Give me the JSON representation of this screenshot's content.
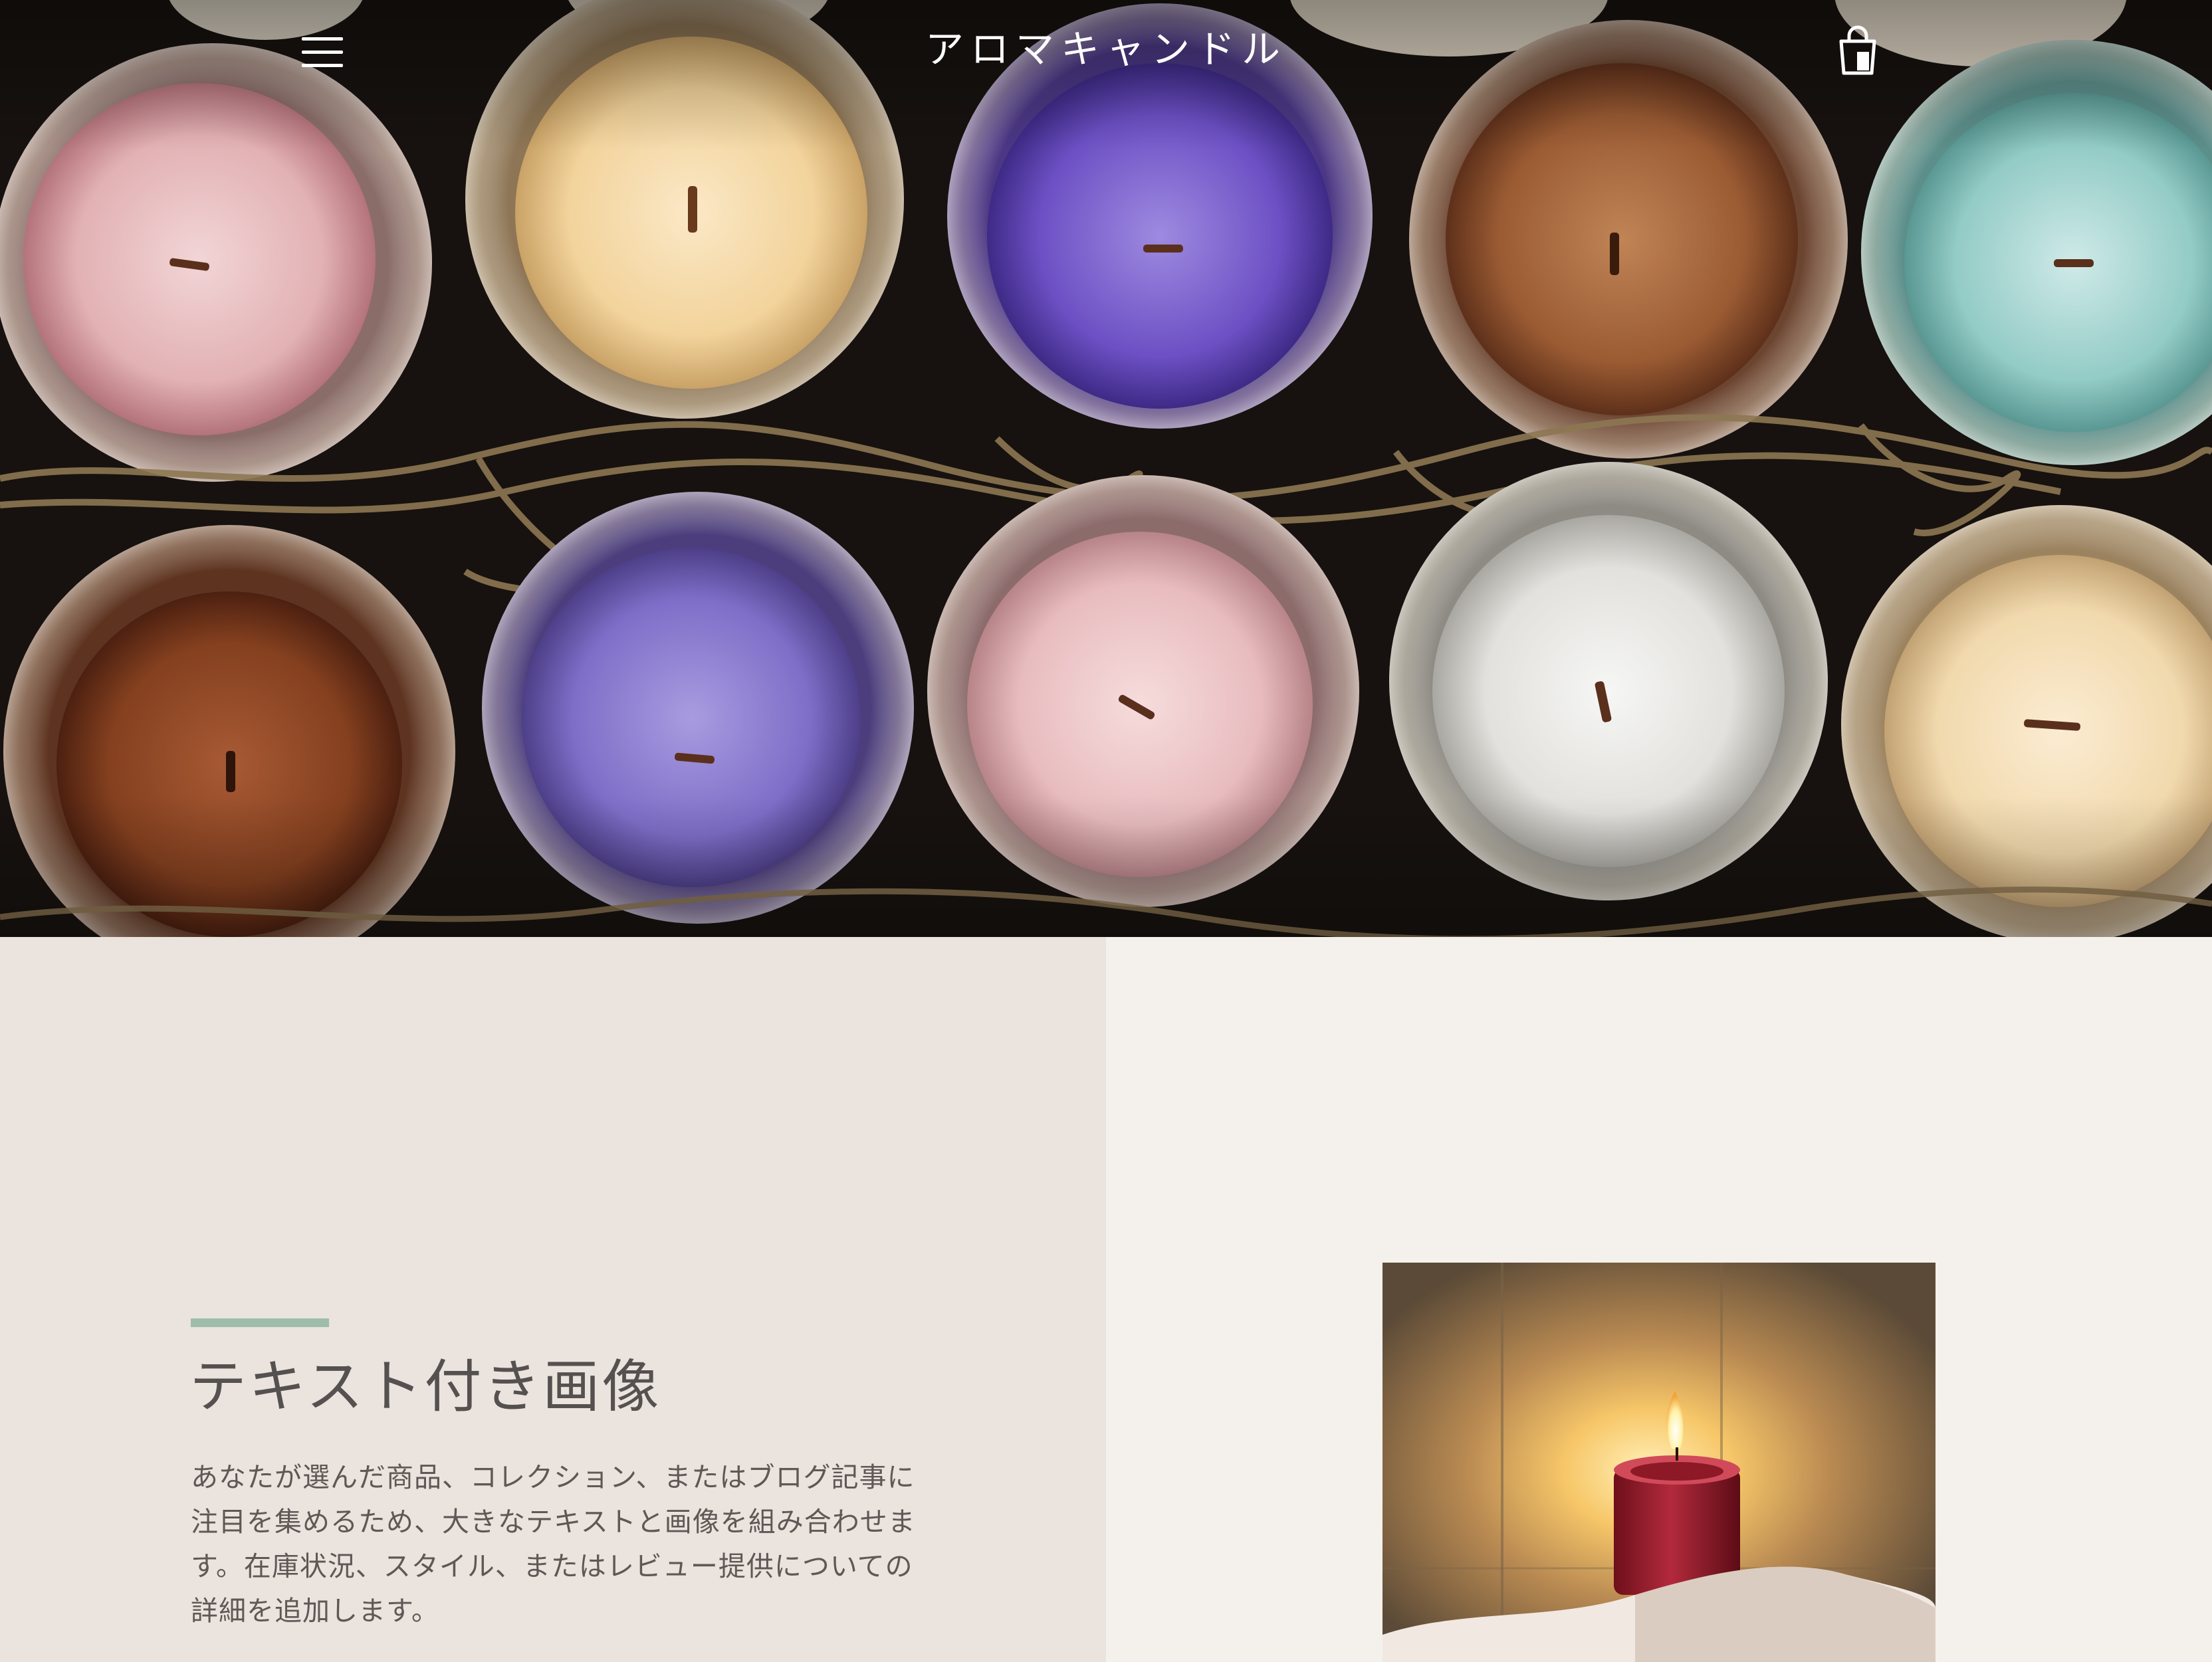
{
  "header": {
    "site_title": "アロマキャンドル",
    "menu_icon": "hamburger-menu-icon",
    "cart_icon": "shopping-bag-icon",
    "text_color": "#ffffff"
  },
  "hero": {
    "image_description_icon": "candle-jars-hero-image"
  },
  "image_with_text": {
    "title": "テキスト付き画像",
    "body": "あなたが選んだ商品、コレクション、またはブログ記事に注目を集めるため、大きなテキストと画像を組み合わせます。在庫状況、スタイル、またはレビュー提供についての詳細を追加します。",
    "accent_color": "#9dbdaa",
    "left_background": "#ebe3dd",
    "right_background": "#f4f1ec",
    "image_icon": "lit-red-candle-image"
  }
}
